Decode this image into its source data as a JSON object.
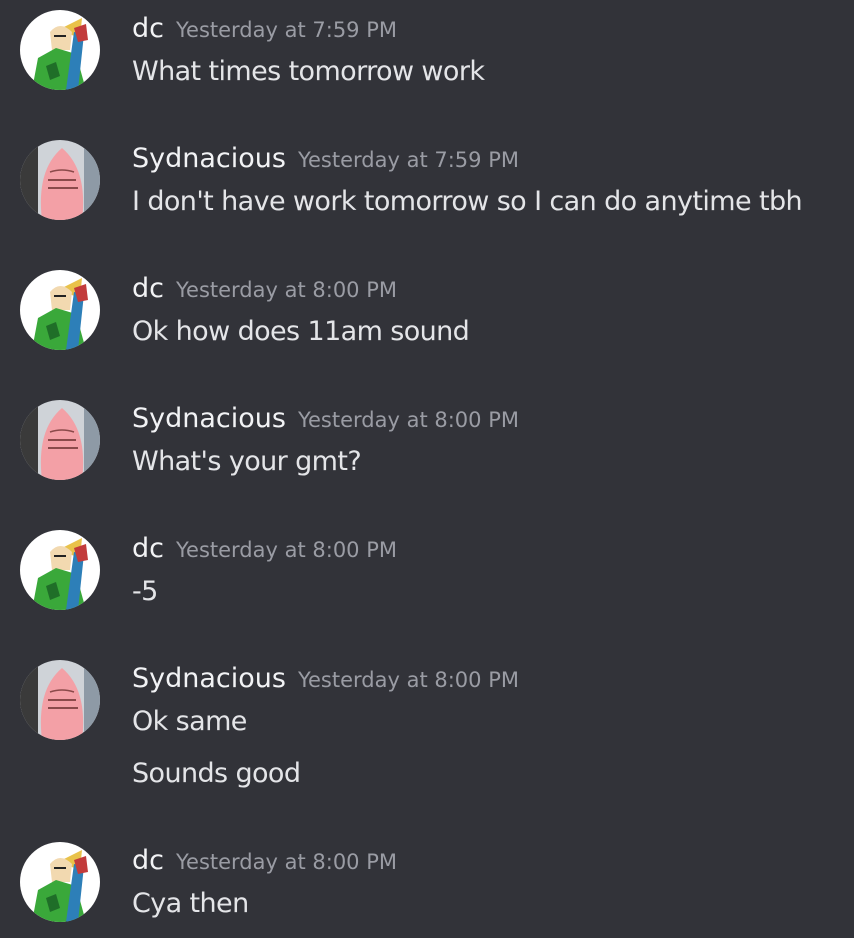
{
  "colors": {
    "background": "#323339",
    "author": "#f2f3f5",
    "timestamp": "#9a9ca4",
    "text": "#e4e5e8"
  },
  "messages": [
    {
      "author": "dc",
      "avatar": "link-avatar",
      "timestamp": "Yesterday at 7:59 PM",
      "lines": [
        "What times tomorrow work"
      ]
    },
    {
      "author": "Sydnacious",
      "avatar": "patrick-avatar",
      "timestamp": "Yesterday at 7:59 PM",
      "lines": [
        "I don't have work tomorrow so I can do anytime tbh"
      ]
    },
    {
      "author": "dc",
      "avatar": "link-avatar",
      "timestamp": "Yesterday at 8:00 PM",
      "lines": [
        "Ok how does 11am sound"
      ]
    },
    {
      "author": "Sydnacious",
      "avatar": "patrick-avatar",
      "timestamp": "Yesterday at 8:00 PM",
      "lines": [
        "What's your gmt?"
      ]
    },
    {
      "author": "dc",
      "avatar": "link-avatar",
      "timestamp": "Yesterday at 8:00 PM",
      "lines": [
        "-5"
      ]
    },
    {
      "author": "Sydnacious",
      "avatar": "patrick-avatar",
      "timestamp": "Yesterday at 8:00 PM",
      "lines": [
        "Ok same",
        "Sounds good"
      ]
    },
    {
      "author": "dc",
      "avatar": "link-avatar",
      "timestamp": "Yesterday at 8:00 PM",
      "lines": [
        "Cya then"
      ]
    }
  ]
}
